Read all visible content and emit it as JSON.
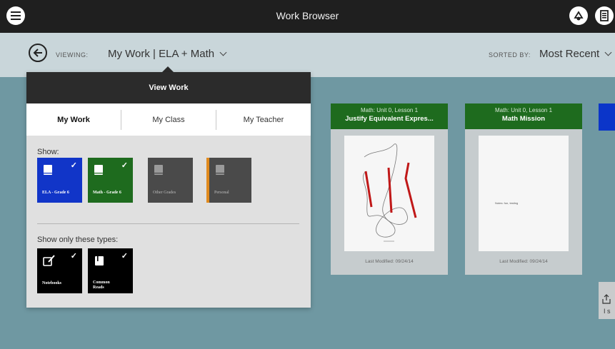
{
  "window": {
    "title": "Work Browser"
  },
  "toolbar": {
    "viewing_label": "VIEWING:",
    "viewing_value": "My Work | ELA + Math",
    "sorted_label": "SORTED BY:",
    "sorted_value": "Most Recent"
  },
  "popover": {
    "title": "View Work",
    "tabs": [
      {
        "label": "My Work",
        "active": true
      },
      {
        "label": "My Class",
        "active": false
      },
      {
        "label": "My Teacher",
        "active": false
      }
    ],
    "show_label": "Show:",
    "grade_tiles": [
      {
        "label": "ELA - Grade 6",
        "checked": true,
        "color": "#1135c8"
      },
      {
        "label": "Math - Grade 6",
        "checked": true,
        "color": "#1e6b1e"
      },
      {
        "label": "Other Grades",
        "checked": false,
        "color": "#4a4a4a"
      },
      {
        "label": "Personal",
        "checked": false,
        "color": "#4a4a4a",
        "accent": "#e08a1e"
      }
    ],
    "types_label": "Show only these types:",
    "type_tiles": [
      {
        "label": "Notebooks",
        "checked": true,
        "color": "#000000"
      },
      {
        "label": "Common Reads",
        "checked": true,
        "color": "#000000"
      }
    ]
  },
  "cards": [
    {
      "subtitle": "Math: Unit 0, Lesson 1",
      "title": "Justify Equivalent Expres...",
      "modified": "Last Modified: 09/24/14"
    },
    {
      "subtitle": "Math: Unit 0, Lesson 1",
      "title": "Math Mission",
      "page_text": "Notes: fun, testing",
      "modified": "Last Modified: 09/24/14"
    }
  ],
  "partial_share": {
    "text": "I s"
  },
  "colors": {
    "topbar": "#1f1f1f",
    "subbar": "#c9d6da",
    "background": "#6f98a2",
    "math_green": "#1e6b1e",
    "ela_blue": "#1135c8"
  }
}
